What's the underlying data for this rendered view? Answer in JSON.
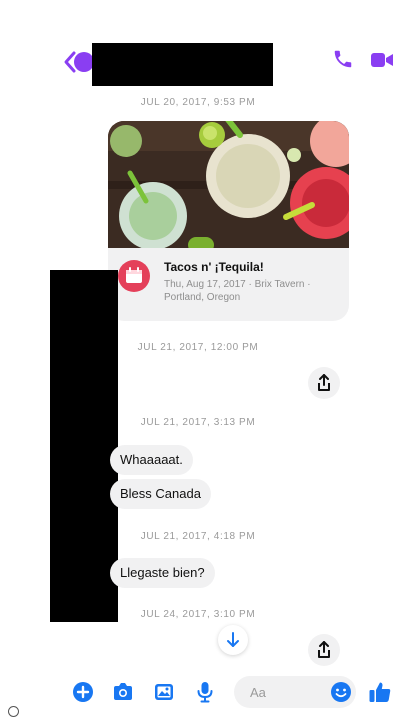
{
  "colors": {
    "accent": "#8a3ef2",
    "messenger_blue": "#1877f2",
    "event_red": "#e4405a",
    "bubble_bg": "#f1f1f2",
    "timestamp": "#9a9a9a"
  },
  "header": {
    "back_icon": "chevron-left-icon",
    "call_icon": "phone-icon",
    "video_icon": "video-camera-icon"
  },
  "thread": {
    "timestamps": [
      "JUL 20, 2017, 9:53 PM",
      "JUL 21, 2017, 12:00 PM",
      "JUL 21, 2017, 3:13 PM",
      "JUL 21, 2017, 4:18 PM",
      "JUL 24, 2017, 3:10 PM"
    ],
    "event": {
      "title": "Tacos n' ¡Tequila!",
      "details": "Thu, Aug 17, 2017 · Brix Tavern · Portland, Oregon",
      "icon": "calendar-icon"
    },
    "messages": [
      "Whaaaaat.",
      "Bless Canada",
      "Llegaste bien?"
    ],
    "share_icon": "share-icon",
    "scroll_icon": "arrow-down-icon"
  },
  "composer": {
    "buttons": [
      "plus-icon",
      "camera-icon",
      "image-icon",
      "microphone-icon"
    ],
    "placeholder": "Aa",
    "emoji_icon": "smiley-icon",
    "like_icon": "thumbs-up-icon"
  }
}
